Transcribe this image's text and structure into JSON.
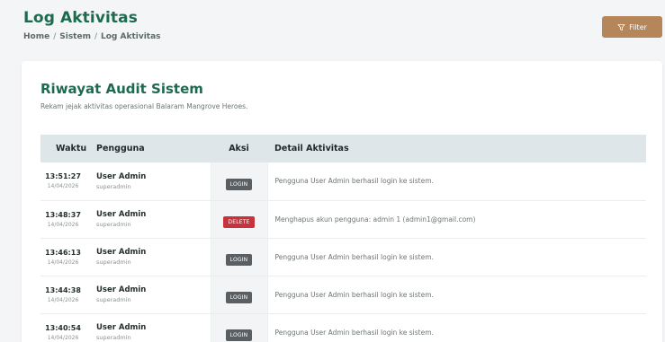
{
  "header": {
    "title": "Log Aktivitas",
    "breadcrumb": [
      "Home",
      "Sistem",
      "Log Aktivitas"
    ],
    "filter_label": "Filter"
  },
  "card": {
    "title": "Riwayat Audit Sistem",
    "subtitle": "Rekam jejak aktivitas operasional Balaram Mangrove Heroes."
  },
  "table": {
    "columns": [
      "Waktu",
      "Pengguna",
      "Aksi",
      "Detail Aktivitas"
    ],
    "rows": [
      {
        "time": "13:51:27",
        "date": "14/04/2026",
        "user": "User Admin",
        "role": "superadmin",
        "action": "LOGIN",
        "detail": "Pengguna User Admin berhasil login ke sistem."
      },
      {
        "time": "13:48:37",
        "date": "14/04/2026",
        "user": "User Admin",
        "role": "superadmin",
        "action": "DELETE",
        "detail": "Menghapus akun pengguna: admin 1 (admin1@gmail.com)"
      },
      {
        "time": "13:46:13",
        "date": "14/04/2026",
        "user": "User Admin",
        "role": "superadmin",
        "action": "LOGIN",
        "detail": "Pengguna User Admin berhasil login ke sistem."
      },
      {
        "time": "13:44:38",
        "date": "14/04/2026",
        "user": "User Admin",
        "role": "superadmin",
        "action": "LOGIN",
        "detail": "Pengguna User Admin berhasil login ke sistem."
      },
      {
        "time": "13:40:54",
        "date": "14/04/2026",
        "user": "User Admin",
        "role": "superadmin",
        "action": "LOGIN",
        "detail": "Pengguna User Admin berhasil login ke sistem."
      }
    ]
  },
  "colors": {
    "brand_green": "#1e6a4e",
    "filter_button": "#b4865a",
    "login_badge": "#5a5f63",
    "delete_badge": "#c8323c"
  },
  "icons": {
    "filter": "filter-icon"
  }
}
